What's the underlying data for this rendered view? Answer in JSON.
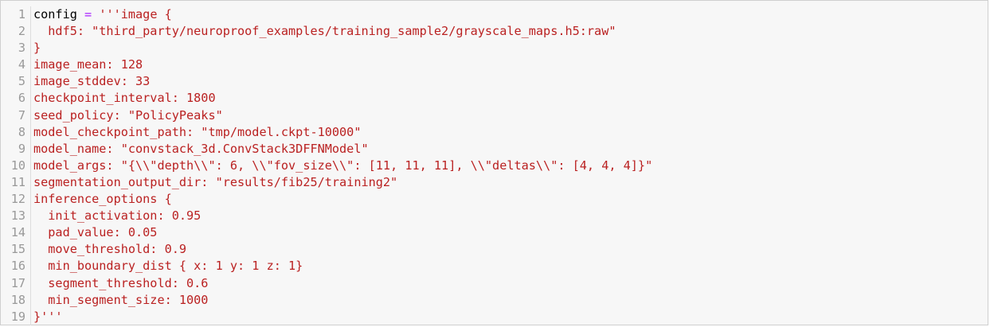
{
  "editor": {
    "lines": [
      {
        "num": "1",
        "parts": [
          {
            "t": "var",
            "v": "config "
          },
          {
            "t": "op",
            "v": "="
          },
          {
            "t": "str",
            "v": " '''image {"
          }
        ]
      },
      {
        "num": "2",
        "parts": [
          {
            "t": "str",
            "v": "  hdf5: \"third_party/neuroproof_examples/training_sample2/grayscale_maps.h5:raw\""
          }
        ]
      },
      {
        "num": "3",
        "parts": [
          {
            "t": "str",
            "v": "}"
          }
        ]
      },
      {
        "num": "4",
        "parts": [
          {
            "t": "str",
            "v": "image_mean: 128"
          }
        ]
      },
      {
        "num": "5",
        "parts": [
          {
            "t": "str",
            "v": "image_stddev: 33"
          }
        ]
      },
      {
        "num": "6",
        "parts": [
          {
            "t": "str",
            "v": "checkpoint_interval: 1800"
          }
        ]
      },
      {
        "num": "7",
        "parts": [
          {
            "t": "str",
            "v": "seed_policy: \"PolicyPeaks\""
          }
        ]
      },
      {
        "num": "8",
        "parts": [
          {
            "t": "str",
            "v": "model_checkpoint_path: \"tmp/model.ckpt-10000\""
          }
        ]
      },
      {
        "num": "9",
        "parts": [
          {
            "t": "str",
            "v": "model_name: \"convstack_3d.ConvStack3DFFNModel\""
          }
        ]
      },
      {
        "num": "10",
        "parts": [
          {
            "t": "str",
            "v": "model_args: \"{\\\\\"depth\\\\\": 6, \\\\\"fov_size\\\\\": [11, 11, 11], \\\\\"deltas\\\\\": [4, 4, 4]}\""
          }
        ]
      },
      {
        "num": "11",
        "parts": [
          {
            "t": "str",
            "v": "segmentation_output_dir: \"results/fib25/training2\""
          }
        ]
      },
      {
        "num": "12",
        "parts": [
          {
            "t": "str",
            "v": "inference_options {"
          }
        ]
      },
      {
        "num": "13",
        "parts": [
          {
            "t": "str",
            "v": "  init_activation: 0.95"
          }
        ]
      },
      {
        "num": "14",
        "parts": [
          {
            "t": "str",
            "v": "  pad_value: 0.05"
          }
        ]
      },
      {
        "num": "15",
        "parts": [
          {
            "t": "str",
            "v": "  move_threshold: 0.9"
          }
        ]
      },
      {
        "num": "16",
        "parts": [
          {
            "t": "str",
            "v": "  min_boundary_dist { x: 1 y: 1 z: 1}"
          }
        ]
      },
      {
        "num": "17",
        "parts": [
          {
            "t": "str",
            "v": "  segment_threshold: 0.6"
          }
        ]
      },
      {
        "num": "18",
        "parts": [
          {
            "t": "str",
            "v": "  min_segment_size: 1000"
          }
        ]
      },
      {
        "num": "19",
        "parts": [
          {
            "t": "str",
            "v": "}'''"
          }
        ]
      }
    ]
  }
}
